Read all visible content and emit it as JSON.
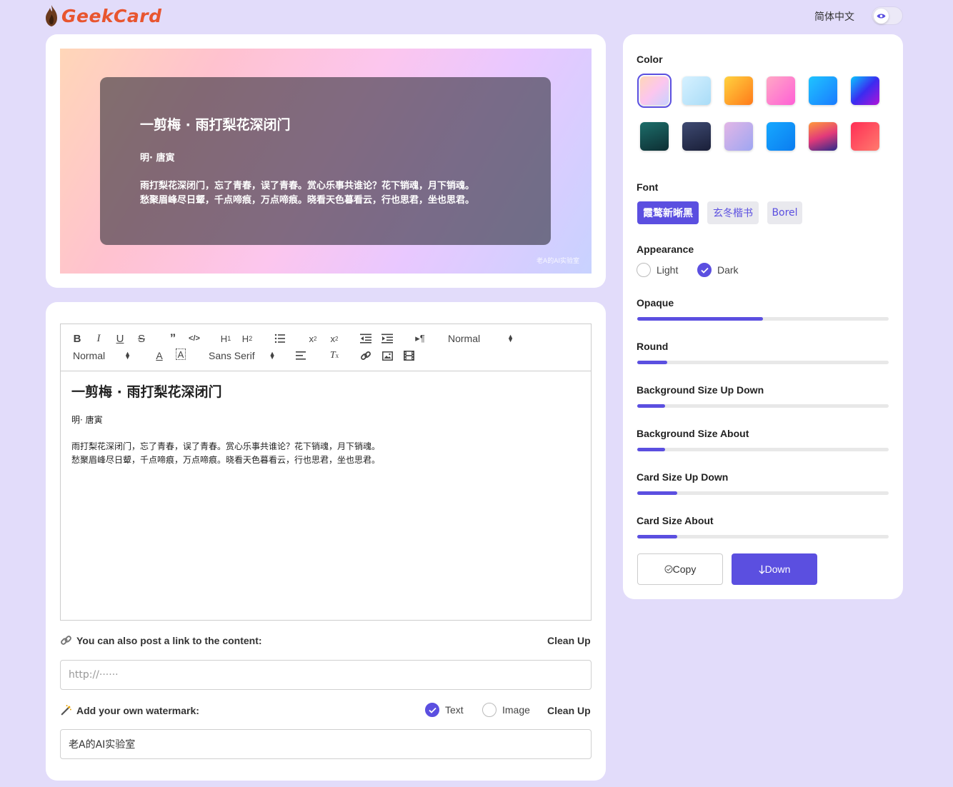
{
  "header": {
    "logo_text": "GeekCard",
    "language": "简体中文"
  },
  "preview": {
    "title": "一剪梅 · 雨打梨花深闭门",
    "author": "明· 唐寅",
    "lines": [
      "雨打梨花深闭门，忘了青春，误了青春。赏心乐事共谁论？花下销魂，月下销魂。",
      "愁聚眉峰尽日颦，千点啼痕，万点啼痕。晓看天色暮看云，行也思君，坐也思君。"
    ],
    "watermark": "老A的AI实验室"
  },
  "editor": {
    "toolbar": {
      "header_select": "Normal",
      "size_select": "Normal",
      "font_select": "Sans Serif"
    },
    "content": {
      "title": "一剪梅 · 雨打梨花深闭门",
      "author": "明· 唐寅",
      "lines": [
        "雨打梨花深闭门，忘了青春，误了青春。赏心乐事共谁论？花下销魂，月下销魂。",
        "愁聚眉峰尽日颦，千点啼痕，万点啼痕。晓看天色暮看云，行也思君，坐也思君。"
      ]
    },
    "link_label": "You can also post a link to the content:",
    "link_cleanup": "Clean Up",
    "link_placeholder": "http://······",
    "watermark_label": "Add your own watermark:",
    "watermark_text_option": "Text",
    "watermark_image_option": "Image",
    "watermark_text_selected": true,
    "watermark_cleanup": "Clean Up",
    "watermark_value": "老A的AI实验室"
  },
  "settings": {
    "color_label": "Color",
    "colors": [
      {
        "name": "pink-pastel",
        "gradient": "linear-gradient(135deg,#ffd6b8,#fcc6ee,#c8d2ff)",
        "selected": true
      },
      {
        "name": "sky-light",
        "gradient": "linear-gradient(135deg,#d6f1ff,#a9dcf7)"
      },
      {
        "name": "orange",
        "gradient": "linear-gradient(135deg,#ffd23f,#ff7a1a)"
      },
      {
        "name": "pink-magenta",
        "gradient": "linear-gradient(135deg,#ffa8c5,#ff5fd6)"
      },
      {
        "name": "blue",
        "gradient": "linear-gradient(135deg,#1fc4ff,#1a7bff)"
      },
      {
        "name": "blue-violet",
        "gradient": "linear-gradient(135deg,#08c7ff,#3a2cf0,#b013d8)"
      },
      {
        "name": "teal-dark",
        "gradient": "linear-gradient(160deg,#1d6e6a,#0d2e33)"
      },
      {
        "name": "navy-dark",
        "gradient": "linear-gradient(160deg,#3e4a72,#1a1f38)"
      },
      {
        "name": "lavender",
        "gradient": "linear-gradient(135deg,#e2b6e6,#9ea6f2)"
      },
      {
        "name": "azure",
        "gradient": "linear-gradient(135deg,#16a8ff,#0b7cf0)"
      },
      {
        "name": "sunset",
        "gradient": "linear-gradient(160deg,#ff9a3c,#e23a7a,#2c2a8a)"
      },
      {
        "name": "red",
        "gradient": "linear-gradient(135deg,#ff2e55,#ff7a6e)"
      }
    ],
    "font_label": "Font",
    "fonts": [
      "霞鹜新晰黑",
      "玄冬楷书",
      "Borel"
    ],
    "appearance_label": "Appearance",
    "appearance_light": "Light",
    "appearance_dark": "Dark",
    "appearance_dark_selected": true,
    "sliders": [
      {
        "label": "Opaque",
        "value": 0.5
      },
      {
        "label": "Round",
        "value": 0.12
      },
      {
        "label": "Background Size Up Down",
        "value": 0.11
      },
      {
        "label": "Background Size About",
        "value": 0.11
      },
      {
        "label": "Card Size Up Down",
        "value": 0.16
      },
      {
        "label": "Card Size About",
        "value": 0.16
      }
    ],
    "copy_label": "Copy",
    "down_label": "Down"
  },
  "colors": {
    "accent": "#5b4fe0",
    "logo": "#e8552f",
    "page_bg": "#e2dcfa"
  }
}
